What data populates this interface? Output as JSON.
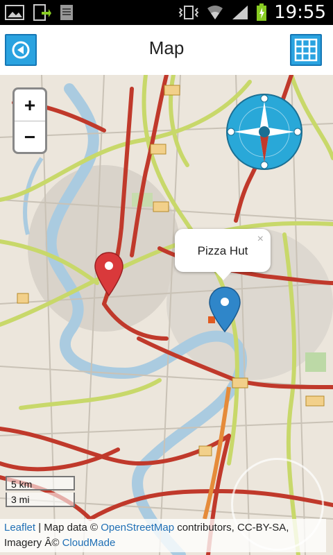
{
  "status_bar": {
    "time": "19:55"
  },
  "app_bar": {
    "title": "Map",
    "back_icon": "back-arrow-icon",
    "grid_icon": "grid-icon"
  },
  "map": {
    "zoom_in_label": "+",
    "zoom_out_label": "−",
    "popup_text": "Pizza Hut",
    "popup_close": "×",
    "scale_km": "5 km",
    "scale_mi": "3 mi",
    "attribution": {
      "leaflet": "Leaflet",
      "sep1": " | Map data © ",
      "osm": "OpenStreetMap",
      "sep2": " contributors, CC-BY-SA,",
      "imagery": "Imagery Â© ",
      "cloudmade": "CloudMade"
    },
    "markers": {
      "red": "#d9393b",
      "blue": "#2f86c9"
    }
  },
  "colors": {
    "accent": "#2aa3e0",
    "road_major": "#c0392b",
    "road_secondary": "#c8d86a"
  }
}
